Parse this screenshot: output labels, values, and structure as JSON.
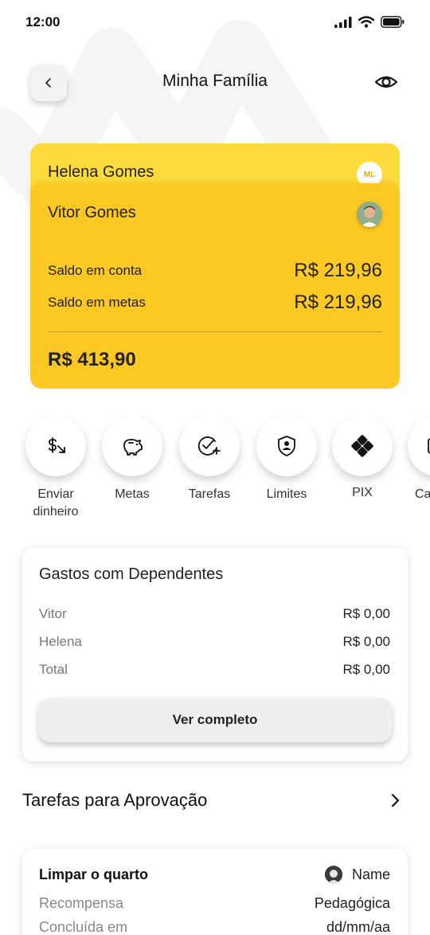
{
  "status_bar": {
    "time": "12:00"
  },
  "header": {
    "title": "Minha Família"
  },
  "cards": {
    "secondary": {
      "name": "Helena Gomes",
      "avatar_initials": "ML"
    },
    "primary": {
      "name": "Vitor Gomes",
      "rows": [
        {
          "label": "Saldo em conta",
          "value": "R$ 219,96"
        },
        {
          "label": "Saldo em metas",
          "value": "R$ 219,96"
        }
      ],
      "total": "R$ 413,90"
    }
  },
  "actions": [
    {
      "label_line1": "Enviar",
      "label_line2": "dinheiro",
      "icon": "send-money-icon"
    },
    {
      "label_line1": "Metas",
      "label_line2": "",
      "icon": "piggy-bank-icon"
    },
    {
      "label_line1": "Tarefas",
      "label_line2": "",
      "icon": "check-add-icon"
    },
    {
      "label_line1": "Limites",
      "label_line2": "",
      "icon": "shield-user-icon"
    },
    {
      "label_line1": "PIX",
      "label_line2": "",
      "icon": "pix-icon"
    },
    {
      "label_line1": "Ca",
      "label_line2": "",
      "icon": "card-icon"
    }
  ],
  "expenses": {
    "title": "Gastos com Dependentes",
    "rows": [
      {
        "label": "Vitor",
        "value": "R$ 0,00"
      },
      {
        "label": "Helena",
        "value": "R$ 0,00"
      },
      {
        "label": "Total",
        "value": "R$ 0,00"
      }
    ],
    "button_label": "Ver completo"
  },
  "approvals": {
    "title": "Tarefas para Aprovação",
    "task": {
      "title": "Limpar o quarto",
      "user": "Name",
      "rows": [
        {
          "label": "Recompensa",
          "value": "Pedagógica"
        },
        {
          "label": "Concluída em",
          "value": "dd/mm/aa"
        }
      ]
    }
  },
  "colors": {
    "card_primary": "#fcc821",
    "card_secondary": "#fedb3c",
    "background": "#ffffff"
  }
}
